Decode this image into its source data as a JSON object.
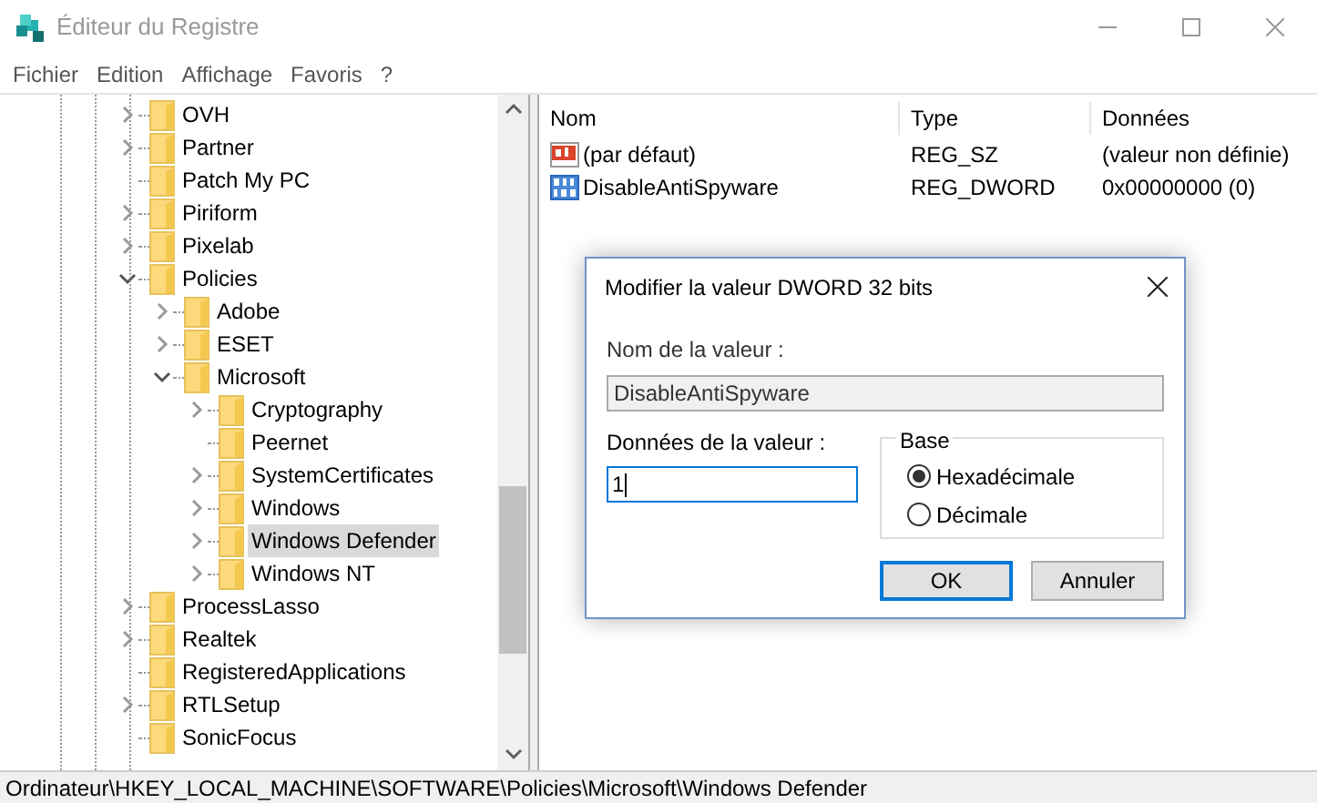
{
  "window": {
    "title": "Éditeur du Registre"
  },
  "menu": [
    "Fichier",
    "Edition",
    "Affichage",
    "Favoris",
    "?"
  ],
  "tree": [
    {
      "name": "OVH",
      "kind": "collapsed",
      "selected": false
    },
    {
      "name": "Partner",
      "kind": "collapsed",
      "selected": false
    },
    {
      "name": "Patch My PC",
      "kind": "leaf",
      "selected": false
    },
    {
      "name": "Piriform",
      "kind": "collapsed",
      "selected": false
    },
    {
      "name": "Pixelab",
      "kind": "collapsed",
      "selected": false
    },
    {
      "name": "Policies",
      "kind": "expanded",
      "selected": false,
      "children": [
        {
          "name": "Adobe",
          "kind": "collapsed",
          "selected": false
        },
        {
          "name": "ESET",
          "kind": "collapsed",
          "selected": false
        },
        {
          "name": "Microsoft",
          "kind": "expanded",
          "selected": false,
          "children": [
            {
              "name": "Cryptography",
              "kind": "collapsed",
              "selected": false
            },
            {
              "name": "Peernet",
              "kind": "leaf",
              "selected": false
            },
            {
              "name": "SystemCertificates",
              "kind": "collapsed",
              "selected": false
            },
            {
              "name": "Windows",
              "kind": "collapsed",
              "selected": false
            },
            {
              "name": "Windows Defender",
              "kind": "collapsed",
              "selected": true
            },
            {
              "name": "Windows NT",
              "kind": "collapsed",
              "selected": false
            }
          ]
        }
      ]
    },
    {
      "name": "ProcessLasso",
      "kind": "collapsed",
      "selected": false
    },
    {
      "name": "Realtek",
      "kind": "collapsed",
      "selected": false
    },
    {
      "name": "RegisteredApplications",
      "kind": "leaf",
      "selected": false
    },
    {
      "name": "RTLSetup",
      "kind": "collapsed",
      "selected": false
    },
    {
      "name": "SonicFocus",
      "kind": "leaf",
      "selected": false
    }
  ],
  "values_table": {
    "columns": [
      "Nom",
      "Type",
      "Données"
    ],
    "rows": [
      {
        "kind": "string",
        "name": "(par défaut)",
        "type": "REG_SZ",
        "data": "(valeur non définie)"
      },
      {
        "kind": "binary",
        "name": "DisableAntiSpyware",
        "type": "REG_DWORD",
        "data": "0x00000000 (0)"
      }
    ]
  },
  "dialog": {
    "title": "Modifier la valeur DWORD 32 bits",
    "name_label": "Nom de la valeur :",
    "name_value": "DisableAntiSpyware",
    "data_label": "Données de la valeur :",
    "data_value": "1",
    "base_label": "Base",
    "bases": [
      {
        "label": "Hexadécimale",
        "selected": true
      },
      {
        "label": "Décimale",
        "selected": false
      }
    ],
    "buttons": [
      "OK",
      "Annuler"
    ]
  },
  "status_bar": "Ordinateur\\HKEY_LOCAL_MACHINE\\SOFTWARE\\Policies\\Microsoft\\Windows Defender"
}
